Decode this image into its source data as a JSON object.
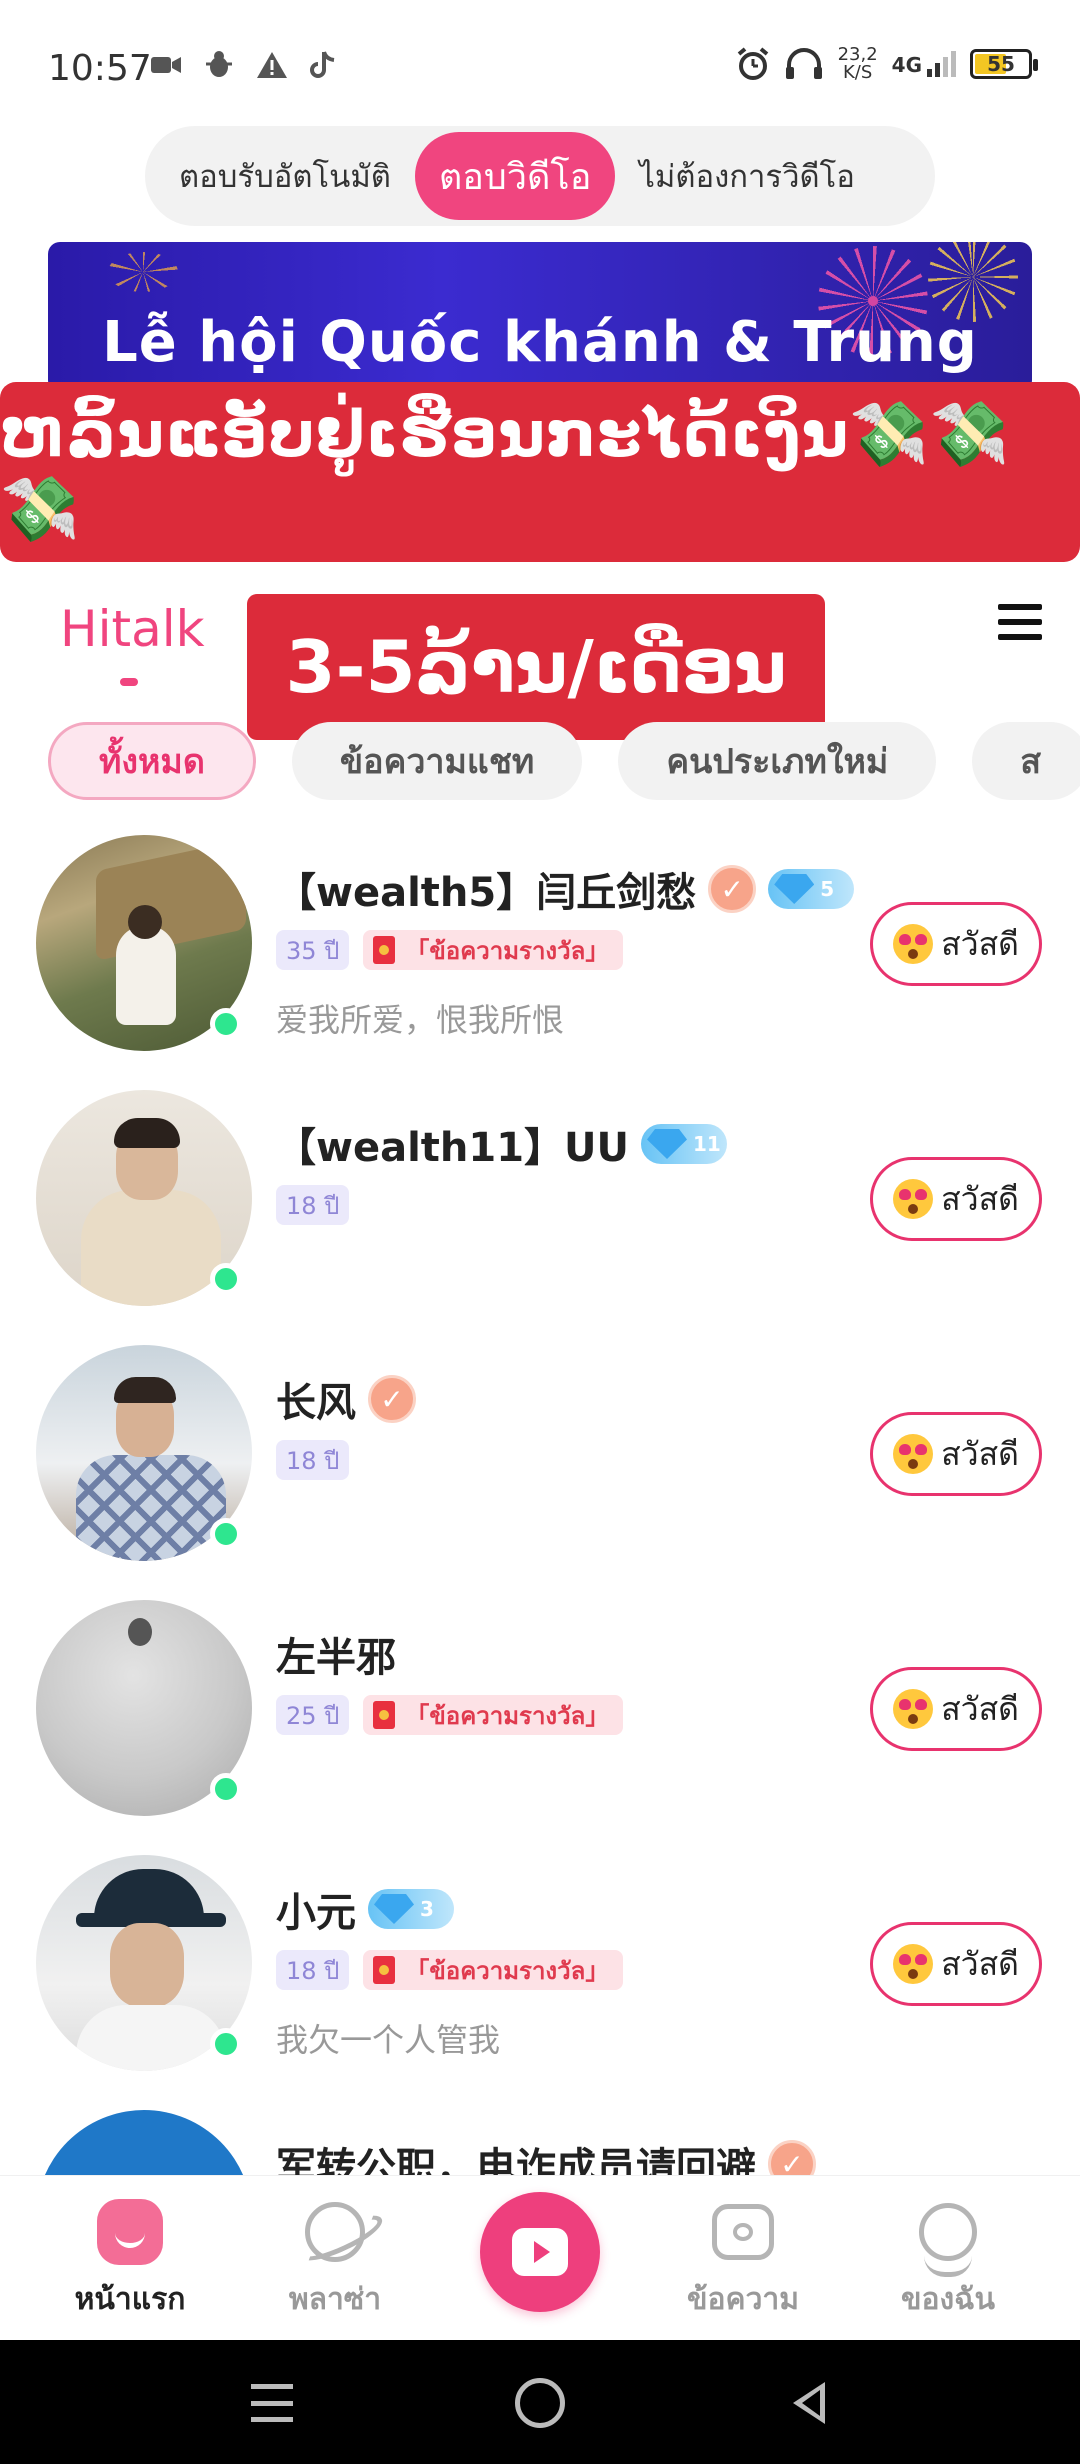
{
  "status_bar": {
    "time": "10:57",
    "net_speed_value": "23,2",
    "net_speed_unit": "K/S",
    "network": "4G",
    "battery": "55",
    "icons": [
      "video-icon",
      "bug-icon",
      "warning-icon",
      "tiktok-icon",
      "alarm-icon",
      "headphones-icon",
      "signal-icon",
      "battery-icon"
    ]
  },
  "answer_mode": {
    "options": [
      "ตอบรับอัตโนมัติ",
      "ตอบวิดีโอ",
      "ไม่ต้องการวิดีโอ"
    ],
    "selected_index": 1
  },
  "banner": {
    "title": "Lễ hội Quốc khánh & Trung thu"
  },
  "promo_strip": {
    "text": "ຫລິ້ນແອັບຢູ່ເຮືອນກະໄດ້ເງິນ💸💸💸"
  },
  "header": {
    "app_name": "Hitalk",
    "promo_box": "3-5ລ້ານ/ເດືອນ"
  },
  "tabs": [
    "ทั้งหมด",
    "ข้อความแชท",
    "คนประเภทใหม่",
    "ส"
  ],
  "users": [
    {
      "name": "【wealth5】闫丘剑愁",
      "verified": true,
      "diamond_level": "5",
      "age": "35 ปี",
      "reward": "「ข้อความรางวัล」",
      "bio": "爱我所爱，恨我所恨",
      "online": true,
      "button": "สวัสดี"
    },
    {
      "name": "【wealth11】UU",
      "verified": false,
      "diamond_level": "11",
      "age": "18 ปี",
      "reward": "",
      "bio": "",
      "online": true,
      "button": "สวัสดี"
    },
    {
      "name": "长风",
      "verified": true,
      "diamond_level": "",
      "age": "18 ปี",
      "reward": "",
      "bio": "",
      "online": true,
      "button": "สวัสดี"
    },
    {
      "name": "左半邪",
      "verified": false,
      "diamond_level": "",
      "age": "25 ปี",
      "reward": "「ข้อความรางวัล」",
      "bio": "",
      "online": true,
      "button": "สวัสดี"
    },
    {
      "name": "小元",
      "verified": false,
      "diamond_level": "3",
      "age": "18 ปี",
      "reward": "「ข้อความรางวัล」",
      "bio": "我欠一个人管我",
      "online": true,
      "button": "สวัสดี"
    },
    {
      "name": "军转公职，电诈成员请回避",
      "verified": true,
      "diamond_level": "",
      "age": "",
      "reward": "",
      "bio": "",
      "online": false,
      "button": ""
    }
  ],
  "bottom_nav": {
    "items": [
      "หน้าแรก",
      "พลาซ่า",
      "ข้อความ",
      "ของฉัน"
    ],
    "active_index": 0
  },
  "colors": {
    "accent": "#f0457f",
    "promo_red": "#dc2b3a",
    "banner_blue": "#2a1aa8",
    "online_green": "#2ee68f"
  }
}
